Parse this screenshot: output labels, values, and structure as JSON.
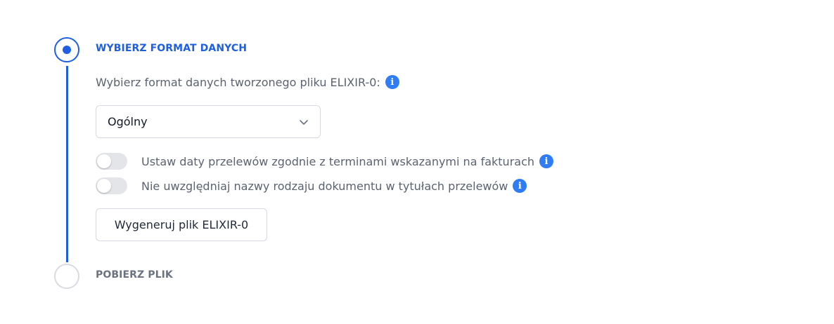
{
  "steps": [
    {
      "title": "WYBIERZ FORMAT DANYCH",
      "state": "active"
    },
    {
      "title": "POBIERZ PLIK",
      "state": "inactive"
    }
  ],
  "format": {
    "label": "Wybierz format danych tworzonego pliku ELIXIR-0:",
    "selected": "Ogólny"
  },
  "toggles": [
    {
      "label": "Ustaw daty przelewów zgodnie z terminami wskazanymi na fakturach",
      "checked": false
    },
    {
      "label": "Nie uwzględniaj nazwy rodzaju dokumentu w tytułach przelewów",
      "checked": false
    }
  ],
  "generate_button": {
    "label": "Wygeneruj plik ELIXIR-0"
  },
  "icons": {
    "info": "i"
  },
  "colors": {
    "accent": "#1d5fe0",
    "info": "#2f7cf6",
    "inactive": "#d8dbe0",
    "toggle_off": "#e3e5e9"
  }
}
